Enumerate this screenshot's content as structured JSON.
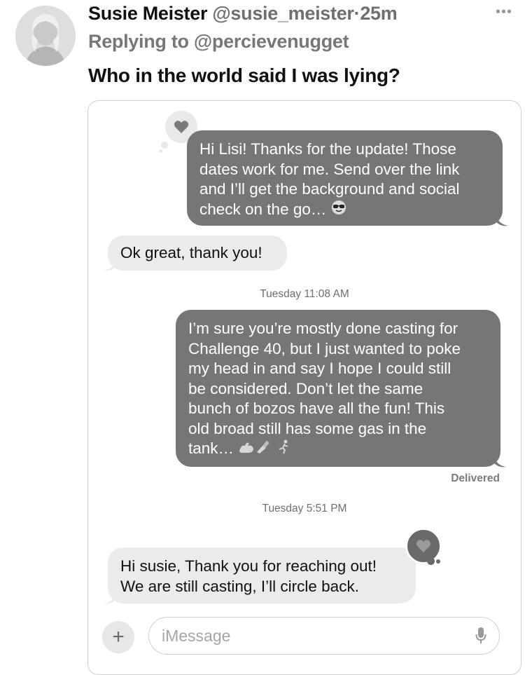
{
  "tweet": {
    "display_name": "Susie Meister",
    "handle": "@susie_meister",
    "separator": "·",
    "time": "25m",
    "more_icon": "ellipsis-icon",
    "reply_prefix": "Replying to",
    "reply_to": "@percievenugget",
    "text": "Who in the world said I was lying?"
  },
  "messages": {
    "msg1_lines": [
      "Hi Lisi! Thanks for the update! Those",
      "dates work for me. Send over the link",
      "and I’ll get the background and social",
      "check on the go…"
    ],
    "msg1_emoji": "sunglasses-emoji",
    "msg1_tapback": "heart-icon",
    "msg2": "Ok great, thank you!",
    "timestamp1": "Tuesday 11:08 AM",
    "msg3_lines": [
      "I’m sure you’re mostly done casting for",
      "Challenge 40, but I just wanted to poke",
      "my head in and say I hope I could still",
      "be considered. Don’t let the same",
      "bunch of bozos have all the fun! This",
      "old broad still has some gas in the",
      "tank…"
    ],
    "msg3_emojis": [
      "flexed-biceps-emoji",
      "nail-polish-emoji",
      "running-emoji"
    ],
    "delivered": "Delivered",
    "timestamp2": "Tuesday 5:51 PM",
    "msg4_lines": [
      "Hi susie, Thank you for reaching out!",
      "We are still casting, I’ll circle back."
    ],
    "msg4_tapback": "heart-icon"
  },
  "compose": {
    "plus_label": "+",
    "placeholder": "iMessage",
    "mic_icon": "microphone-icon"
  },
  "colors": {
    "sent_bubble": "#767676",
    "received_bubble": "#ebebeb",
    "muted_text": "#6f6f6f"
  }
}
